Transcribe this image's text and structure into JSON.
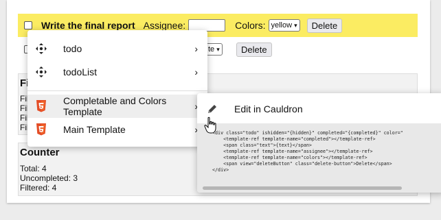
{
  "todos": [
    {
      "text": "Write the final report",
      "assignee_label": "Assignee:",
      "assignee_value": "",
      "colors_label": "Colors:",
      "color": "yellow",
      "delete_label": "Delete"
    },
    {
      "color_partial": "te",
      "delete_label": "Delete"
    }
  ],
  "filters": {
    "title": "Fi",
    "lines": [
      "Fil",
      "Fil",
      "Fil",
      "Fil"
    ]
  },
  "counter": {
    "title": "Counter",
    "total": "Total: 4",
    "uncompleted": "Uncompleted: 3",
    "filtered": "Filtered: 4"
  },
  "context_menu": {
    "items": [
      {
        "label": "todo",
        "icon": "move-icon",
        "arrow": "›"
      },
      {
        "label": "todoList",
        "icon": "move-icon",
        "arrow": "›"
      },
      {
        "label": "Completable and Colors Template",
        "icon": "html5-icon",
        "arrow": "›"
      },
      {
        "label": "Main Template",
        "icon": "html5-icon",
        "arrow": "›"
      }
    ]
  },
  "submenu": {
    "action_label": "Edit in Cauldron",
    "code": "<div class=\"todo\" ishidden=\"{hidden}\" completed=\"{completed}\" color=\"\n    <template-ref template-name=\"completed\"></template-ref>\n    <span class=\"text\">{text}</span>\n    <template-ref template-name=\"assignee\"></template-ref>\n    <template-ref template-name=\"colors\"></template-ref>\n    <span view=\"deleteButton\" class=\"delete-button\">Delete</span>\n</div>"
  },
  "colors": {
    "highlight": "#fbec62",
    "html5_orange": "#e44d26"
  }
}
